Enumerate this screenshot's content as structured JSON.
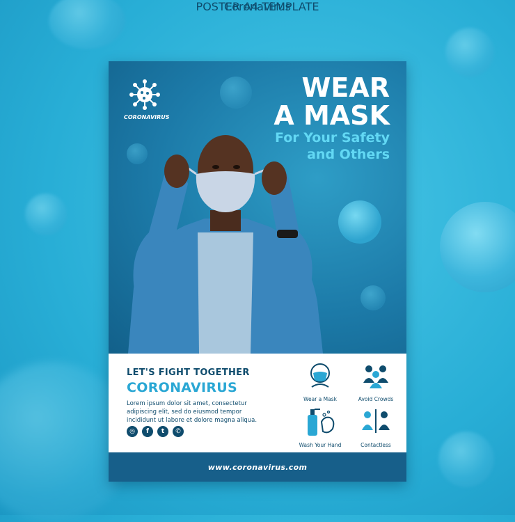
{
  "header": {
    "title": "POSTER A4 TEMPLATE",
    "subtitle": "Coronavirus"
  },
  "poster": {
    "logo_label": "CORONAVIRUS",
    "headline_line1": "WEAR",
    "headline_line2": "A MASK",
    "subhead_line1": "For Your Safety",
    "subhead_line2": "and Others",
    "kicker": "LET'S FIGHT TOGETHER",
    "kicker_big": "CORONAVIRUS",
    "body_text": "Lorem ipsum dolor sit amet, consectetur adipiscing elit, sed do eiusmod tempor incididunt ut labore et dolore magna aliqua.",
    "socials": [
      {
        "icon": "instagram-icon",
        "glyph": "◎"
      },
      {
        "icon": "facebook-icon",
        "glyph": "f"
      },
      {
        "icon": "twitter-icon",
        "glyph": "t"
      },
      {
        "icon": "whatsapp-icon",
        "glyph": "✆"
      }
    ],
    "tips": [
      {
        "icon": "mask-icon",
        "label": "Wear a Mask"
      },
      {
        "icon": "crowd-icon",
        "label": "Avoid Crowds"
      },
      {
        "icon": "hand-wash-icon",
        "label": "Wash Your Hand"
      },
      {
        "icon": "contactless-icon",
        "label": "Contactless"
      }
    ],
    "website": "www.coronavirus.com"
  },
  "colors": {
    "navy": "#0f4c6d",
    "cyan": "#2aa7d4",
    "light_cyan": "#62d8f4",
    "poster_bg": "#1e6f9a"
  }
}
